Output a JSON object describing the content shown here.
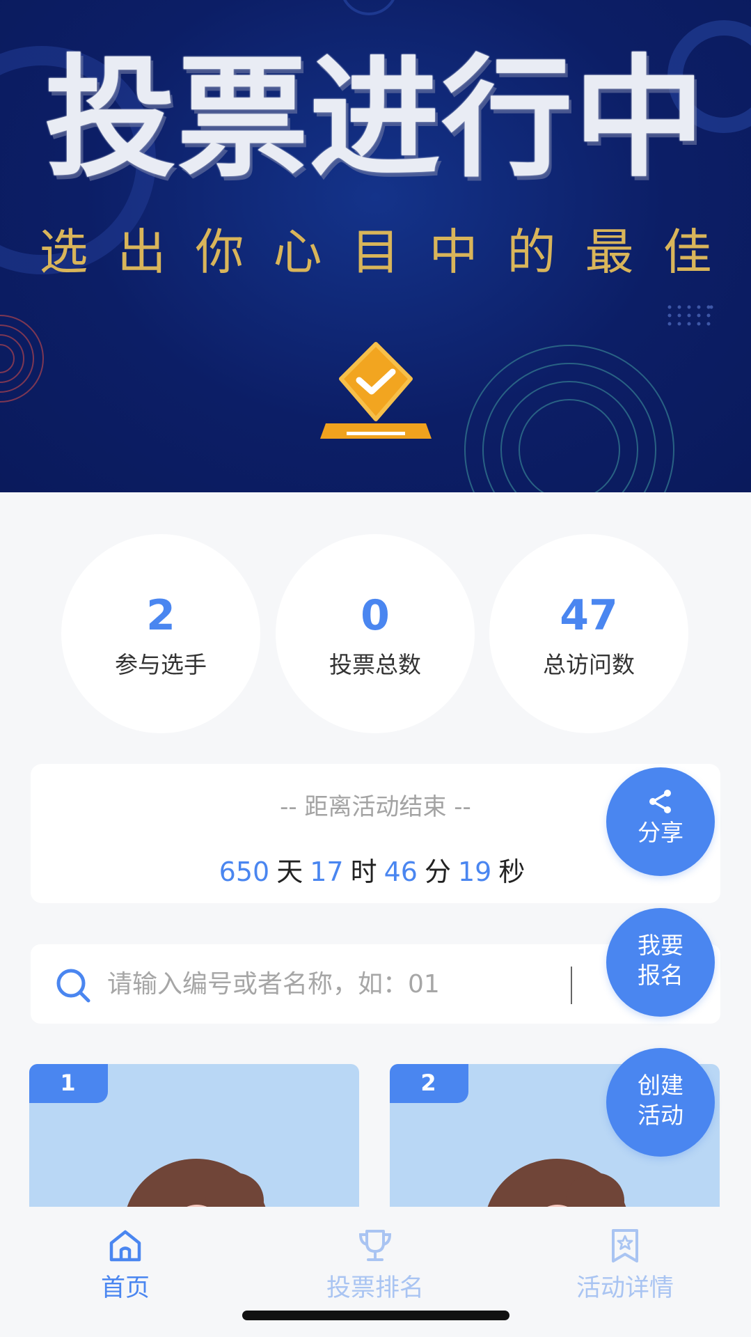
{
  "banner": {
    "title": "投票进行中",
    "subtitle": "选出你心目中的最佳"
  },
  "stats": [
    {
      "value": "2",
      "label": "参与选手"
    },
    {
      "value": "0",
      "label": "投票总数"
    },
    {
      "value": "47",
      "label": "总访问数"
    }
  ],
  "countdown": {
    "title": "-- 距离活动结束 --",
    "days": "650",
    "days_unit": "天",
    "hours": "17",
    "hours_unit": "时",
    "minutes": "46",
    "minutes_unit": "分",
    "seconds": "19",
    "seconds_unit": "秒"
  },
  "search": {
    "placeholder": "请输入编号或者名称，如：01"
  },
  "cards": [
    {
      "number": "1"
    },
    {
      "number": "2"
    }
  ],
  "fabs": {
    "share": "分享",
    "signup_line1": "我要",
    "signup_line2": "报名",
    "create_line1": "创建",
    "create_line2": "活动"
  },
  "tabs": [
    {
      "label": "首页",
      "icon": "home-icon",
      "active": true
    },
    {
      "label": "投票排名",
      "icon": "trophy-icon",
      "active": false
    },
    {
      "label": "活动详情",
      "icon": "badge-star-icon",
      "active": false
    }
  ],
  "colors": {
    "accent": "#4a86f0",
    "banner_bg": "#0c1e66",
    "banner_gold": "#d9b55a",
    "card_bg": "#b9d7f5",
    "inactive_tab": "#a9c4f2"
  }
}
